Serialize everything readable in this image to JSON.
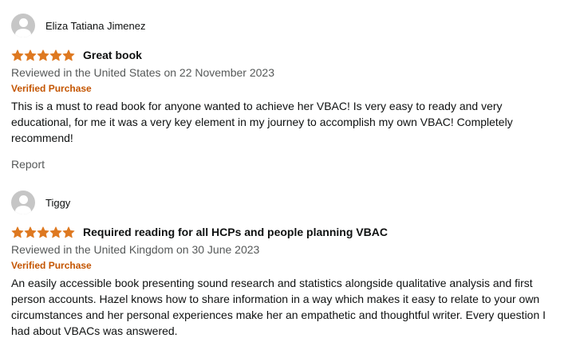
{
  "reviews": [
    {
      "reviewer": "Eliza Tatiana Jimenez",
      "rating": 5,
      "title": "Great book",
      "date": "Reviewed in the United States on 22 November 2023",
      "verified": "Verified Purchase",
      "body": "This is a must to read book for anyone wanted to achieve her VBAC! Is very easy to ready and very educational, for me it was a very key element in my journey to accomplish my own VBAC! Completely recommend!",
      "report": "Report"
    },
    {
      "reviewer": "Tiggy",
      "rating": 5,
      "title": "Required reading for all HCPs and people planning VBAC",
      "date": "Reviewed in the United Kingdom on 30 June 2023",
      "verified": "Verified Purchase",
      "body": "An easily accessible book presenting sound research and statistics alongside qualitative analysis and first person accounts. Hazel knows how to share information in a way which makes it easy to relate to your own circumstances and her personal experiences make her an empathetic and thoughtful writer. Every question I had about VBACs was answered."
    }
  ],
  "colors": {
    "star": "#de7921",
    "verified": "#c45500",
    "secondary_text": "#565959",
    "primary_text": "#0f1111"
  },
  "icons": {
    "avatar": "default-avatar-icon",
    "star": "star-icon"
  }
}
